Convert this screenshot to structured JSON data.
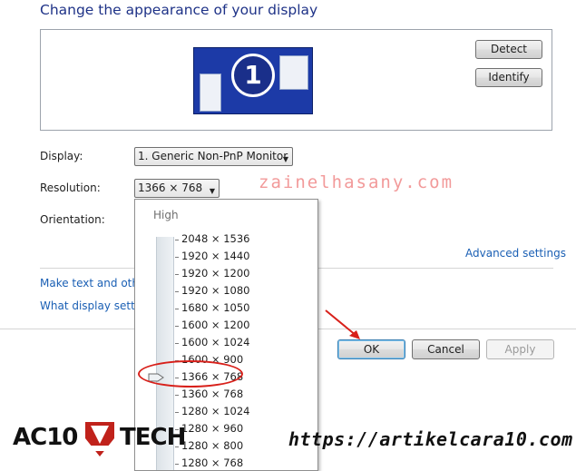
{
  "header": {
    "title": "Change the appearance of your display"
  },
  "preview": {
    "monitor_number": "1",
    "detect_label": "Detect",
    "identify_label": "Identify"
  },
  "settings": {
    "display_label": "Display:",
    "display_value": "1. Generic Non-PnP Monitor",
    "resolution_label": "Resolution:",
    "resolution_value": "1366 × 768",
    "orientation_label": "Orientation:"
  },
  "links": {
    "advanced": "Advanced settings",
    "make_text": "Make text and other",
    "what_display": "What display setting"
  },
  "dropdown": {
    "high_label": "High",
    "selected_index": 7,
    "resolutions": [
      "2048 × 1536",
      "1920 × 1440",
      "1920 × 1200",
      "1920 × 1080",
      "1680 × 1050",
      "1600 × 1200",
      "1600 × 1024",
      "1600 × 900",
      "1366 × 768",
      "1360 × 768",
      "1280 × 1024",
      "1280 × 960",
      "1280 × 800",
      "1280 × 768"
    ]
  },
  "footer": {
    "ok_label": "OK",
    "cancel_label": "Cancel",
    "apply_label": "Apply"
  },
  "overlays": {
    "watermark": "zainelhasany.com",
    "url": "https://artikelcara10.com",
    "logo_left": "AC10",
    "logo_right": "TECH",
    "annotation_color": "#d8201a"
  }
}
